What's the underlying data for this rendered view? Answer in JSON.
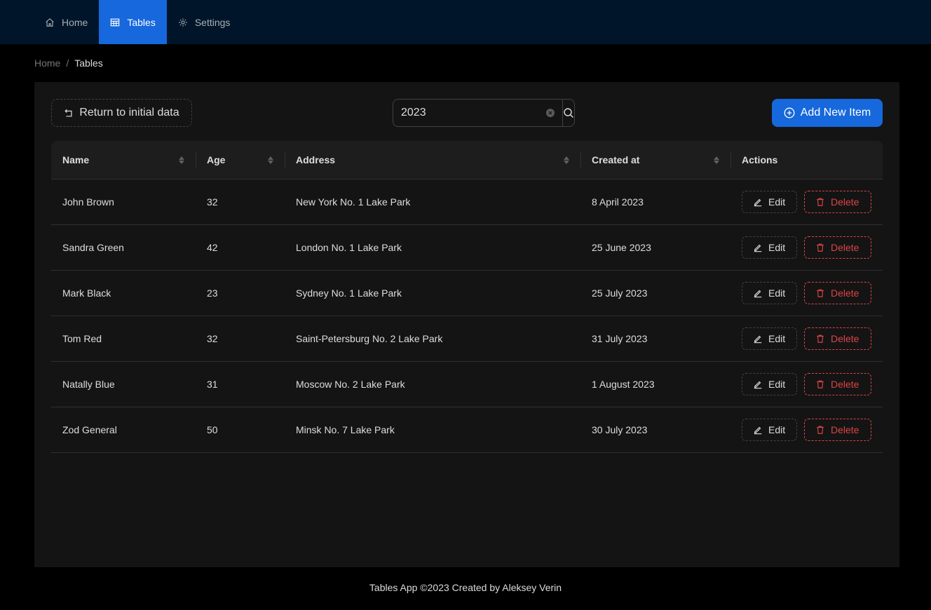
{
  "nav": {
    "items": [
      {
        "label": "Home",
        "icon": "home-icon"
      },
      {
        "label": "Tables",
        "icon": "table-icon",
        "active": true
      },
      {
        "label": "Settings",
        "icon": "gear-icon"
      }
    ]
  },
  "breadcrumb": {
    "home": "Home",
    "separator": "/",
    "current": "Tables"
  },
  "toolbar": {
    "return_label": "Return to initial data",
    "search_value": "2023",
    "add_label": "Add New Item"
  },
  "table": {
    "columns": [
      "Name",
      "Age",
      "Address",
      "Created at",
      "Actions"
    ],
    "edit_label": "Edit",
    "delete_label": "Delete",
    "rows": [
      {
        "name": "John Brown",
        "age": "32",
        "address": "New York No. 1 Lake Park",
        "created": "8 April 2023"
      },
      {
        "name": "Sandra Green",
        "age": "42",
        "address": "London No. 1 Lake Park",
        "created": "25 June 2023"
      },
      {
        "name": "Mark Black",
        "age": "23",
        "address": "Sydney No. 1 Lake Park",
        "created": "25 July 2023"
      },
      {
        "name": "Tom Red",
        "age": "32",
        "address": "Saint-Petersburg No. 2 Lake Park",
        "created": "31 July 2023"
      },
      {
        "name": "Natally Blue",
        "age": "31",
        "address": "Moscow No. 2 Lake Park",
        "created": "1 August 2023"
      },
      {
        "name": "Zod General",
        "age": "50",
        "address": "Minsk No. 7 Lake Park",
        "created": "30 July 2023"
      }
    ]
  },
  "footer": {
    "text": "Tables App ©2023 Created by Aleksey Verin"
  },
  "colors": {
    "primary": "#1668dc",
    "danger": "#dc4446",
    "header_bg": "#001529"
  }
}
